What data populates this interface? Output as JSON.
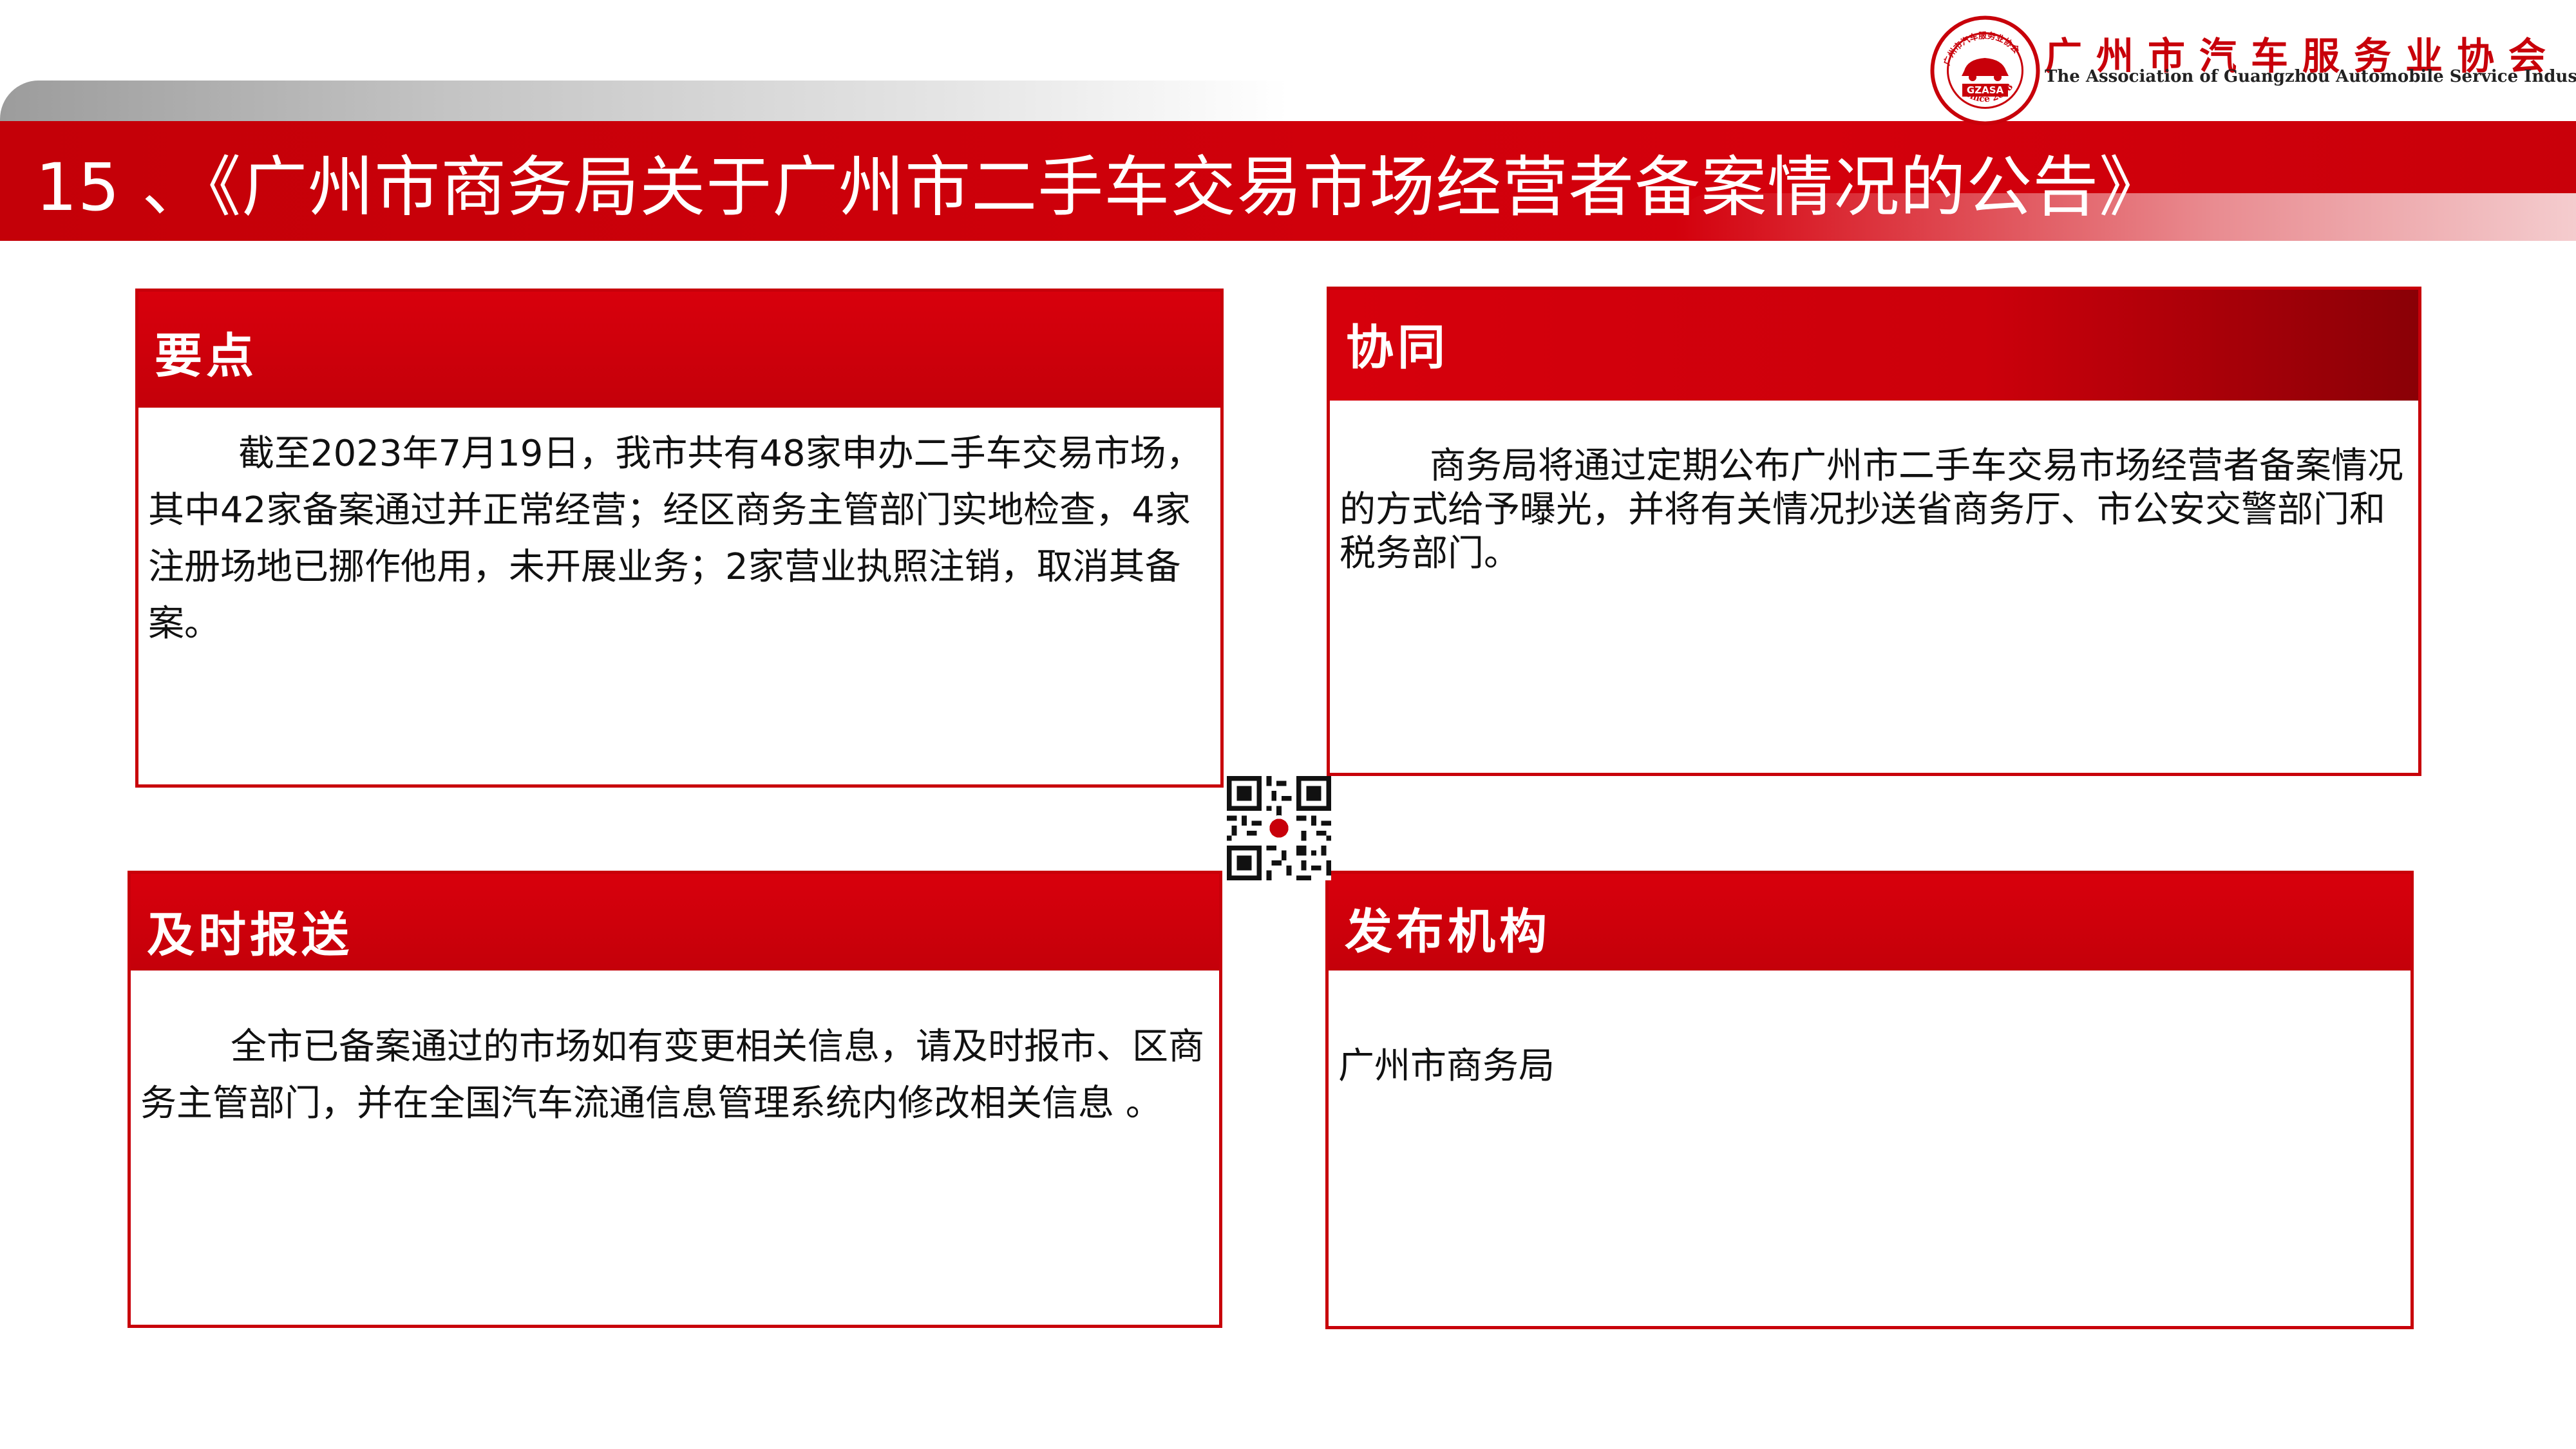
{
  "header": {
    "page_title": "15 、《广州市商务局关于广州市二手车交易市场经营者备案情况的公告》",
    "org_name_cn": "广州市汽车服务业协会",
    "org_name_en": "The Association of Guangzhou Automobile Service Industry",
    "logo_text_top": "广州市汽车服务业协会",
    "logo_abbr": "GZASA",
    "logo_year": "Since 2008"
  },
  "cards": {
    "key_points": {
      "title": "要点",
      "body": "截至2023年7月19日，我市共有48家申办二手车交易市场，其中42家备案通过并正常经营；经区商务主管部门实地检查，4家注册场地已挪作他用，未开展业务；2家营业执照注销，取消其备案。"
    },
    "collaboration": {
      "title": "协同",
      "body": "商务局将通过定期公布广州市二手车交易市场经营者备案情况的方式给予曝光，并将有关情况抄送省商务厅、市公安交警部门和税务部门。"
    },
    "timely_report": {
      "title": "及时报送",
      "body": "全市已备案通过的市场如有变更相关信息，请及时报市、区商务主管部门，并在全国汽车流通信息管理系统内修改相关信息 。"
    },
    "issuer": {
      "title": "发布机构",
      "body": "广州市商务局"
    }
  },
  "colors": {
    "brand_red": "#c8000a",
    "dark_red": "#8a0006",
    "text": "#111111"
  },
  "icons": {
    "logo": "association-seal-icon",
    "qr": "qr-code-icon"
  }
}
